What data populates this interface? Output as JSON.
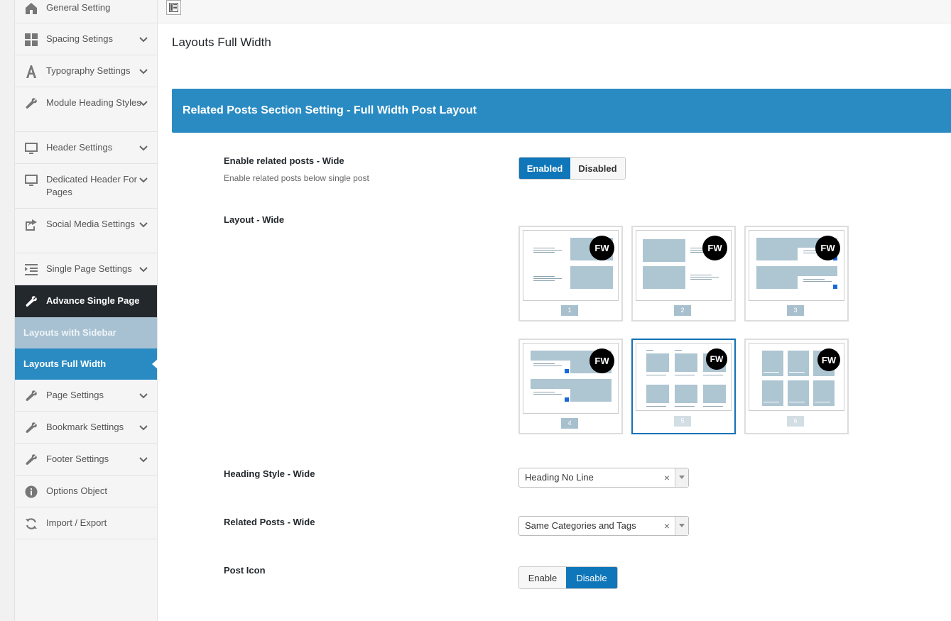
{
  "sidebar": {
    "items": [
      {
        "label": "General Setting",
        "icon": "home-icon",
        "chevron": false
      },
      {
        "label": "Spacing Setings",
        "icon": "grid-icon",
        "chevron": true
      },
      {
        "label": "Typography Settings",
        "icon": "typography-icon",
        "chevron": true
      },
      {
        "label": "Module Heading Styles",
        "icon": "wrench-icon",
        "chevron": true
      },
      {
        "label": "Header Settings",
        "icon": "monitor-icon",
        "chevron": true
      },
      {
        "label": "Dedicated Header For Pages",
        "icon": "monitor-icon",
        "chevron": true
      },
      {
        "label": "Social Media Settings",
        "icon": "share-icon",
        "chevron": true
      },
      {
        "label": "Single Page Settings",
        "icon": "indent-icon",
        "chevron": true
      },
      {
        "label": "Advance Single Page",
        "icon": "wrench-icon",
        "chevron": false
      }
    ],
    "sub_items": [
      "Layouts with Sidebar",
      "Layouts Full Width"
    ],
    "items_after": [
      {
        "label": "Page Settings",
        "icon": "wrench-icon",
        "chevron": true
      },
      {
        "label": "Bookmark Settings",
        "icon": "wrench-icon",
        "chevron": true
      },
      {
        "label": "Footer Settings",
        "icon": "wrench-icon",
        "chevron": true
      },
      {
        "label": "Options Object",
        "icon": "info-icon",
        "chevron": false
      },
      {
        "label": "Import / Export",
        "icon": "refresh-icon",
        "chevron": false
      }
    ]
  },
  "main": {
    "page_title": "Layouts Full Width",
    "section_title": "Related Posts Section Setting - Full Width Post Layout",
    "enable_related": {
      "label": "Enable related posts - Wide",
      "desc": "Enable related posts below single post",
      "options": [
        "Enabled",
        "Disabled"
      ],
      "selected": "Enabled"
    },
    "layout": {
      "label": "Layout - Wide",
      "badge": "FW",
      "options": [
        "1",
        "2",
        "3",
        "4",
        "5",
        "6"
      ],
      "selected": "5"
    },
    "heading_style": {
      "label": "Heading Style - Wide",
      "value": "Heading No Line",
      "clear": "×"
    },
    "related_posts": {
      "label": "Related Posts - Wide",
      "value": "Same Categories and Tags",
      "clear": "×"
    },
    "post_icon": {
      "label": "Post Icon",
      "options": [
        "Enable",
        "Disable"
      ],
      "selected": "Disable"
    }
  },
  "colors": {
    "accent": "#2a8bc3",
    "button_on": "#0f76b9",
    "sidebar_active": "#23282d"
  }
}
